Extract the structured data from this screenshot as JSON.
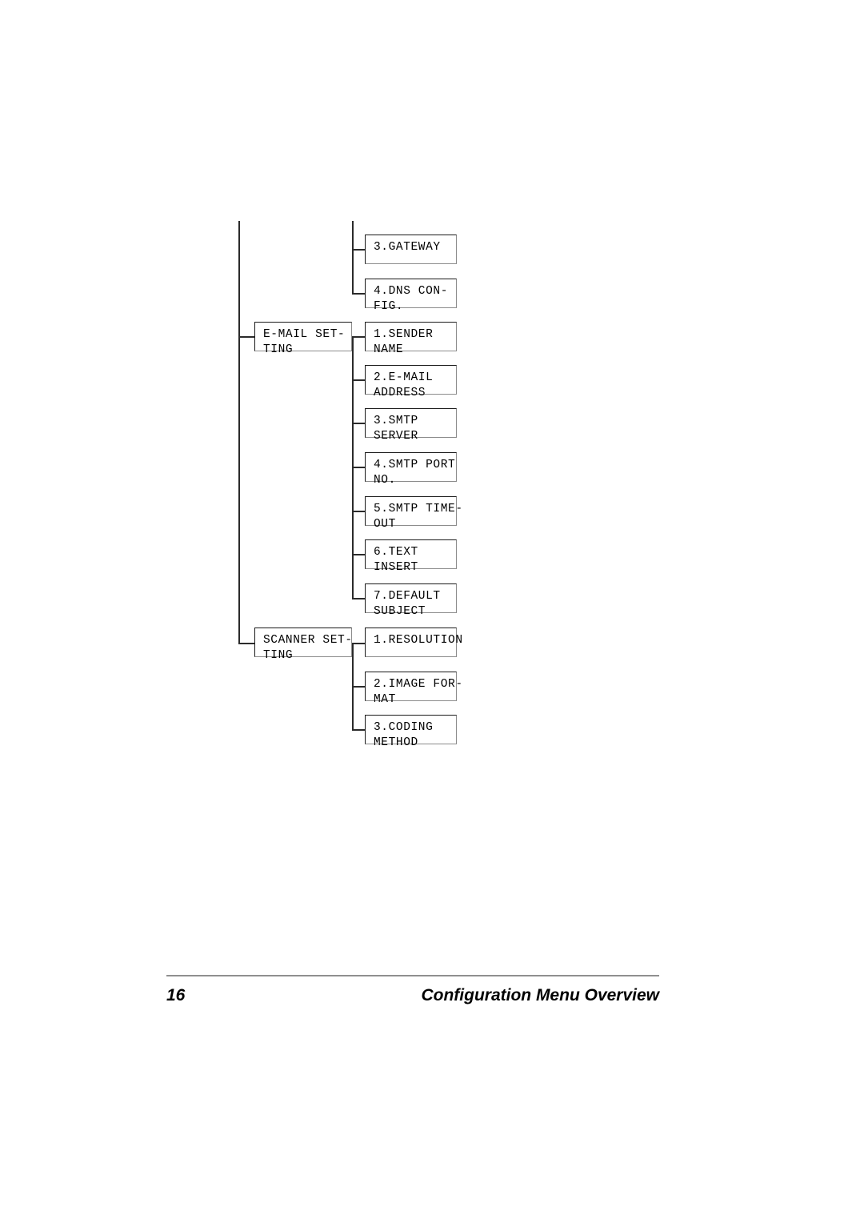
{
  "document": {
    "page_number": "16",
    "footer_title": "Configuration Menu Overview"
  },
  "diagram": {
    "type": "menu-tree",
    "trunk_label": "main-menu-trunk",
    "groups": [
      {
        "name": "network-setting-continued",
        "parent_label": null,
        "children": [
          {
            "label": "3.GATEWAY",
            "line1": "3.GATEWAY",
            "line2": ""
          },
          {
            "label": "4.DNS CONFIG.",
            "line1": "4.DNS CON-",
            "line2": "FIG."
          }
        ]
      },
      {
        "name": "e-mail-setting",
        "parent_label": "E-MAIL SETTING",
        "parent_line1": "E-MAIL SET-",
        "parent_line2": "TING",
        "children": [
          {
            "label": "1.SENDER NAME",
            "line1": "1.SENDER",
            "line2": "NAME"
          },
          {
            "label": "2.E-MAIL ADDRESS",
            "line1": "2.E-MAIL",
            "line2": "ADDRESS"
          },
          {
            "label": "3.SMTP SERVER",
            "line1": "3.SMTP",
            "line2": "SERVER"
          },
          {
            "label": "4.SMTP PORT NO.",
            "line1": "4.SMTP PORT",
            "line2": "NO."
          },
          {
            "label": "5.SMTP TIMEOUT",
            "line1": "5.SMTP TIME-",
            "line2": "OUT"
          },
          {
            "label": "6.TEXT INSERT",
            "line1": "6.TEXT",
            "line2": "INSERT"
          },
          {
            "label": "7.DEFAULT SUBJECT",
            "line1": "7.DEFAULT",
            "line2": "SUBJECT"
          }
        ]
      },
      {
        "name": "scanner-setting",
        "parent_label": "SCANNER SETTING",
        "parent_line1": "SCANNER SET-",
        "parent_line2": "TING",
        "children": [
          {
            "label": "1.RESOLUTION",
            "line1": "1.RESOLUTION",
            "line2": ""
          },
          {
            "label": "2.IMAGE FORMAT",
            "line1": "2.IMAGE FOR-",
            "line2": "MAT"
          },
          {
            "label": "3.CODING METHOD",
            "line1": "3.CODING",
            "line2": "METHOD"
          }
        ]
      }
    ]
  },
  "nodes": {
    "gateway": {
      "line1": "3.GATEWAY",
      "line2": ""
    },
    "dns_config": {
      "line1": "4.DNS CON-",
      "line2": "FIG."
    },
    "email_setting": {
      "line1": "E-MAIL SET-",
      "line2": "TING"
    },
    "sender_name": {
      "line1": "1.SENDER",
      "line2": "NAME"
    },
    "email_address": {
      "line1": "2.E-MAIL",
      "line2": "ADDRESS"
    },
    "smtp_server": {
      "line1": "3.SMTP",
      "line2": "SERVER"
    },
    "smtp_port_no": {
      "line1": "4.SMTP PORT",
      "line2": "NO."
    },
    "smtp_timeout": {
      "line1": "5.SMTP TIME-",
      "line2": "OUT"
    },
    "text_insert": {
      "line1": "6.TEXT",
      "line2": "INSERT"
    },
    "default_subject": {
      "line1": "7.DEFAULT",
      "line2": "SUBJECT"
    },
    "scanner_setting": {
      "line1": "SCANNER SET-",
      "line2": "TING"
    },
    "resolution": {
      "line1": "1.RESOLUTION",
      "line2": ""
    },
    "image_format": {
      "line1": "2.IMAGE FOR-",
      "line2": "MAT"
    },
    "coding_method": {
      "line1": "3.CODING",
      "line2": "METHOD"
    }
  },
  "colors": {
    "page_background": "#ffffff",
    "text": "#000000",
    "box_border_dark": "#1a1a1a",
    "box_border_light": "#8c8c8c",
    "connector": "#2b2b2b",
    "footer_rule": "#8f8f8f"
  }
}
